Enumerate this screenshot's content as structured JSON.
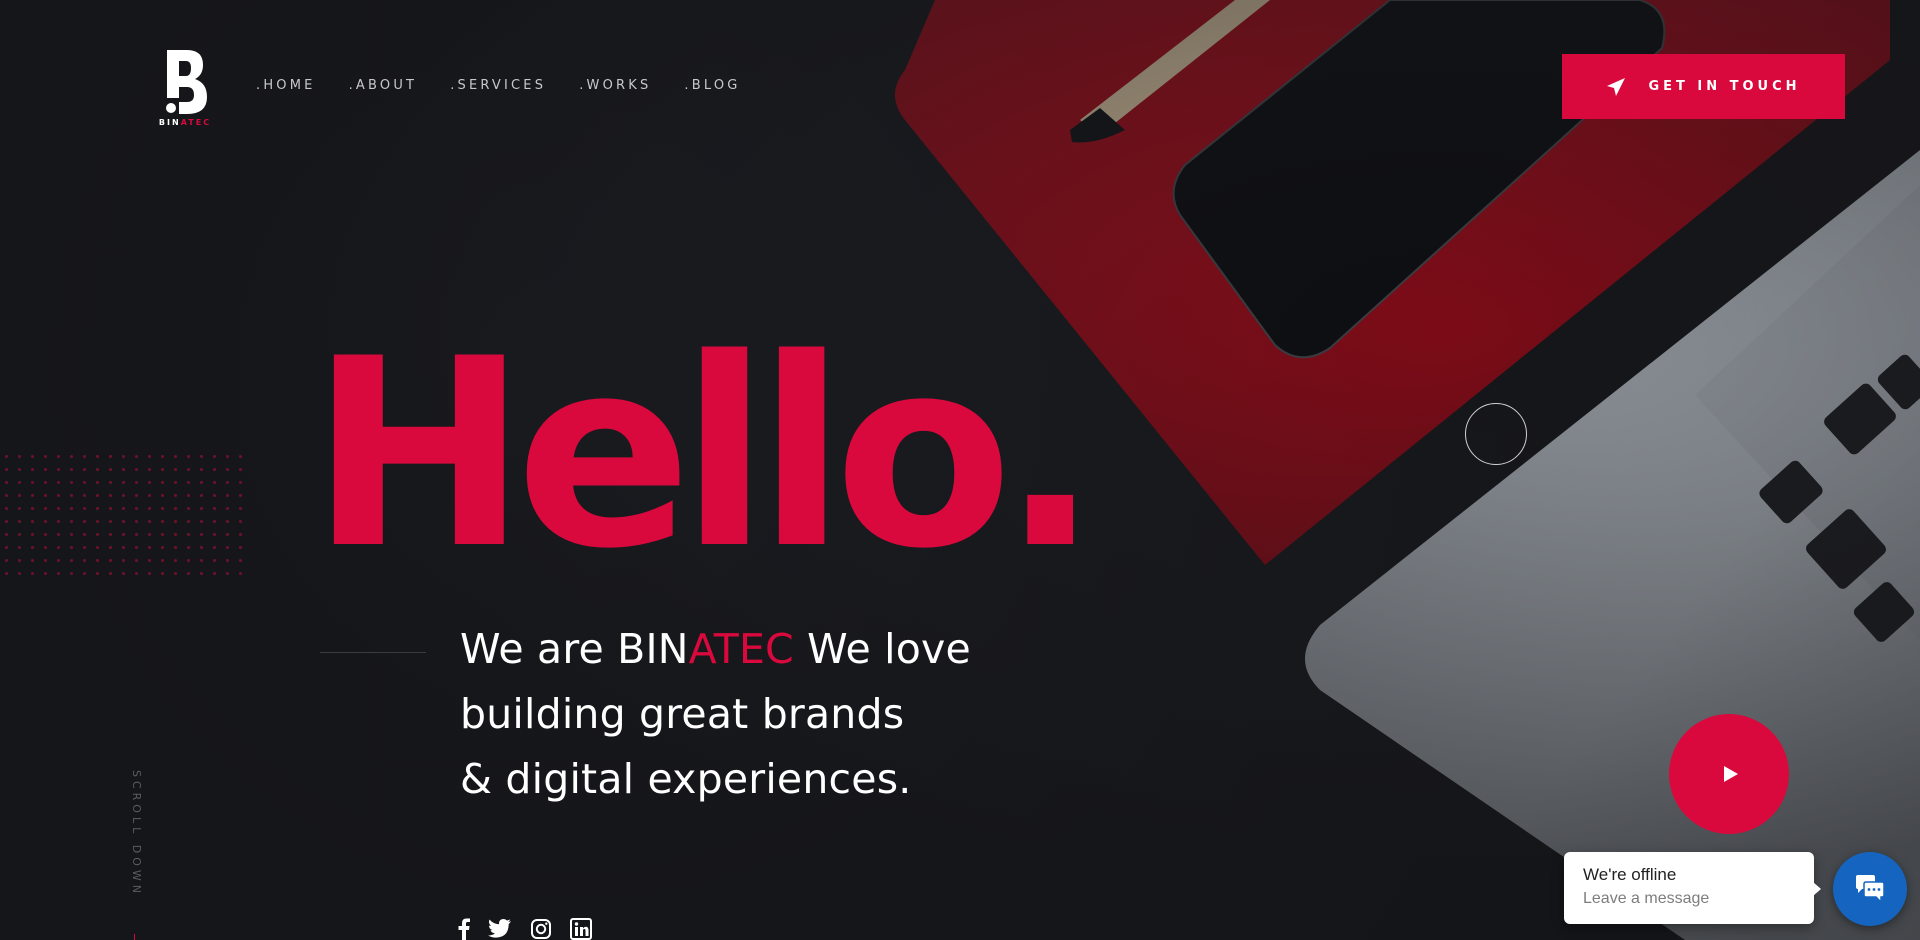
{
  "brand": {
    "logo_letter": "B",
    "name_prefix": "BIN",
    "name_suffix": "ATEC",
    "accent_color": "#d9093d",
    "dark_bg": "#16171b"
  },
  "nav": {
    "items": [
      {
        "label": ".HOME"
      },
      {
        "label": ".ABOUT"
      },
      {
        "label": ".SERVICES"
      },
      {
        "label": ".WORKS"
      },
      {
        "label": ".BLOG"
      }
    ]
  },
  "header": {
    "cta_label": "GET IN TOUCH",
    "cta_icon": "paper-plane-icon"
  },
  "hero": {
    "title": "Hello.",
    "tagline_line1_a": "We are ",
    "tagline_brand_a": "BIN",
    "tagline_brand_b": "ATEC",
    "tagline_line1_b": " We love",
    "tagline_line2": "building great brands",
    "tagline_line3": "& digital experiences."
  },
  "scroll": {
    "label": "SCROLL DOWN"
  },
  "social": {
    "icons": [
      "facebook-icon",
      "twitter-icon",
      "instagram-icon",
      "linkedin-icon"
    ]
  },
  "video": {
    "icon": "play-icon"
  },
  "chat": {
    "status": "We're offline",
    "subtitle": "Leave a message",
    "button_color": "#1565c0",
    "icon": "chat-icon"
  }
}
